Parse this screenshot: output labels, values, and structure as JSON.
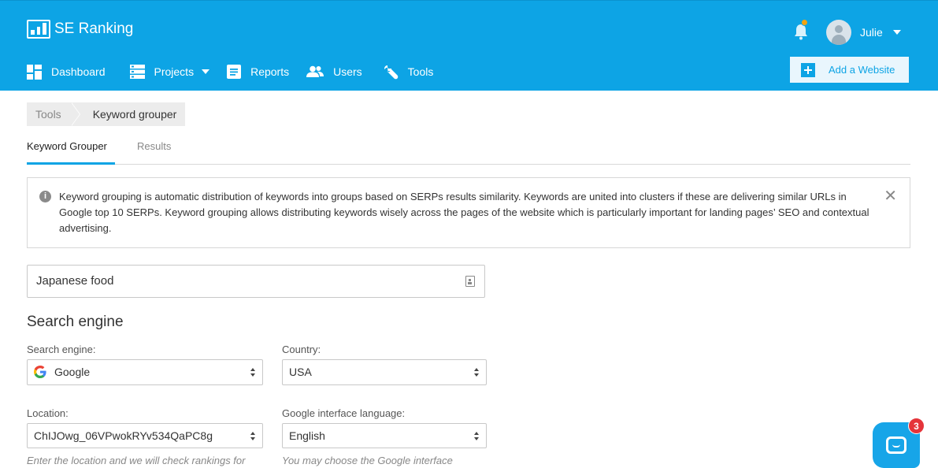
{
  "header": {
    "brand": "SE Ranking",
    "user_name": "Julie",
    "nav": [
      {
        "label": "Dashboard",
        "icon": "dashboard-icon"
      },
      {
        "label": "Projects",
        "icon": "projects-icon"
      },
      {
        "label": "Reports",
        "icon": "reports-icon"
      },
      {
        "label": "Users",
        "icon": "users-icon"
      },
      {
        "label": "Tools",
        "icon": "wrench-icon"
      }
    ],
    "add_website_label": "Add a Website",
    "colors": {
      "header_bg": "#0da4e5",
      "accent": "#0da4e5",
      "notification_dot": "#f4a30f"
    }
  },
  "breadcrumb": {
    "items": [
      "Tools",
      "Keyword grouper"
    ]
  },
  "tabs": [
    "Keyword Grouper",
    "Results"
  ],
  "info": {
    "text": "Keyword grouping is automatic distribution of keywords into groups based on SERPs results similarity. Keywords are united into clusters if these are delivering similar URLs in Google top 10 SERPs. Keyword grouping allows distributing keywords wisely across the pages of the website which is particularly important for landing pages’ SEO and contextual advertising."
  },
  "form": {
    "project_name": "Japanese food",
    "section_title": "Search engine",
    "search_engine": {
      "label": "Search engine:",
      "value": "Google"
    },
    "country": {
      "label": "Country:",
      "value": "USA"
    },
    "location": {
      "label": "Location:",
      "value": "ChIJOwg_06VPwokRYv534QaPC8g",
      "hint": "Enter the location and we will check rankings for"
    },
    "language": {
      "label": "Google interface language:",
      "value": "English",
      "hint": "You may choose the Google interface"
    }
  },
  "chat": {
    "badge_count": "3"
  }
}
